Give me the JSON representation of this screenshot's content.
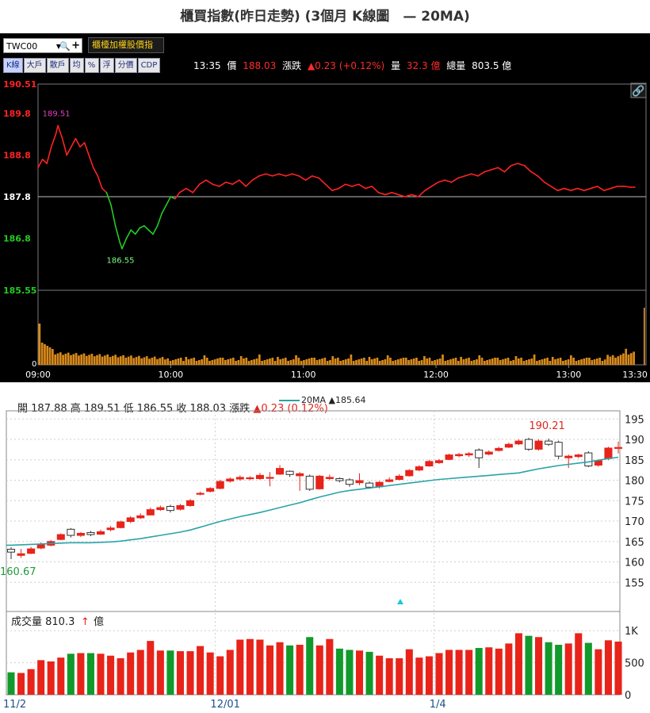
{
  "title": "櫃買指數(昨日走勢) (3個月 K線圖　— 20MA)",
  "intraday": {
    "symbol_value": "TWC00",
    "index_name": "櫃檯加權股價指",
    "tabs": [
      "K線",
      "大戶",
      "散戶",
      "均",
      "%",
      "浮",
      "分價",
      "CDP"
    ],
    "quote": {
      "time": "13:35",
      "price_label": "價",
      "price": "188.03",
      "change_label": "漲跌",
      "change": "▲0.23 (+0.12%)",
      "volume_label": "量",
      "volume": "32.3 億",
      "total_volume_label": "總量",
      "total_volume": "803.5 億"
    },
    "colors": {
      "up": "#ff2222",
      "down": "#22cc22",
      "reference": "#ffffff"
    },
    "chart_data": {
      "type": "line",
      "title": "",
      "reference": 187.8,
      "ylim": [
        185.55,
        190.51
      ],
      "y_tick_labels": [
        "190.51",
        "189.8",
        "188.8",
        "187.8",
        "186.8",
        "185.55"
      ],
      "x_tick_labels": [
        "09:00",
        "10:00",
        "11:00",
        "12:00",
        "13:00",
        "13:30"
      ],
      "annotations": [
        {
          "text": "189.51",
          "x": "09:09",
          "y": 189.51
        },
        {
          "text": "186.55",
          "x": "09:38",
          "y": 186.55
        }
      ],
      "price": [
        [
          "09:00",
          188.5
        ],
        [
          "09:02",
          188.7
        ],
        [
          "09:04",
          188.6
        ],
        [
          "09:06",
          189.0
        ],
        [
          "09:08",
          189.3
        ],
        [
          "09:09",
          189.51
        ],
        [
          "09:11",
          189.2
        ],
        [
          "09:13",
          188.8
        ],
        [
          "09:15",
          189.0
        ],
        [
          "09:17",
          189.2
        ],
        [
          "09:19",
          189.0
        ],
        [
          "09:21",
          189.1
        ],
        [
          "09:23",
          188.8
        ],
        [
          "09:25",
          188.5
        ],
        [
          "09:27",
          188.3
        ],
        [
          "09:29",
          188.0
        ],
        [
          "09:31",
          187.9
        ],
        [
          "09:33",
          187.6
        ],
        [
          "09:35",
          187.1
        ],
        [
          "09:37",
          186.7
        ],
        [
          "09:38",
          186.55
        ],
        [
          "09:40",
          186.8
        ],
        [
          "09:42",
          187.0
        ],
        [
          "09:44",
          186.9
        ],
        [
          "09:46",
          187.05
        ],
        [
          "09:48",
          187.1
        ],
        [
          "09:50",
          187.0
        ],
        [
          "09:52",
          186.9
        ],
        [
          "09:54",
          187.1
        ],
        [
          "09:56",
          187.4
        ],
        [
          "09:58",
          187.6
        ],
        [
          "10:00",
          187.8
        ],
        [
          "10:02",
          187.75
        ],
        [
          "10:04",
          187.9
        ],
        [
          "10:07",
          188.0
        ],
        [
          "10:10",
          187.9
        ],
        [
          "10:13",
          188.1
        ],
        [
          "10:16",
          188.2
        ],
        [
          "10:19",
          188.1
        ],
        [
          "10:22",
          188.05
        ],
        [
          "10:25",
          188.15
        ],
        [
          "10:28",
          188.1
        ],
        [
          "10:31",
          188.2
        ],
        [
          "10:34",
          188.05
        ],
        [
          "10:37",
          188.2
        ],
        [
          "10:40",
          188.3
        ],
        [
          "10:43",
          188.35
        ],
        [
          "10:46",
          188.3
        ],
        [
          "10:49",
          188.35
        ],
        [
          "10:52",
          188.3
        ],
        [
          "10:55",
          188.35
        ],
        [
          "10:58",
          188.3
        ],
        [
          "11:01",
          188.2
        ],
        [
          "11:04",
          188.3
        ],
        [
          "11:07",
          188.25
        ],
        [
          "11:10",
          188.1
        ],
        [
          "11:13",
          187.95
        ],
        [
          "11:16",
          188.0
        ],
        [
          "11:19",
          188.1
        ],
        [
          "11:22",
          188.05
        ],
        [
          "11:25",
          188.1
        ],
        [
          "11:28",
          188.0
        ],
        [
          "11:31",
          188.05
        ],
        [
          "11:34",
          187.9
        ],
        [
          "11:37",
          187.85
        ],
        [
          "11:40",
          187.9
        ],
        [
          "11:43",
          187.85
        ],
        [
          "11:46",
          187.8
        ],
        [
          "11:49",
          187.85
        ],
        [
          "11:52",
          187.8
        ],
        [
          "11:55",
          187.95
        ],
        [
          "11:58",
          188.05
        ],
        [
          "12:01",
          188.15
        ],
        [
          "12:04",
          188.2
        ],
        [
          "12:07",
          188.15
        ],
        [
          "12:10",
          188.25
        ],
        [
          "12:13",
          188.3
        ],
        [
          "12:16",
          188.35
        ],
        [
          "12:19",
          188.3
        ],
        [
          "12:22",
          188.4
        ],
        [
          "12:25",
          188.45
        ],
        [
          "12:28",
          188.5
        ],
        [
          "12:31",
          188.4
        ],
        [
          "12:34",
          188.55
        ],
        [
          "12:37",
          188.6
        ],
        [
          "12:40",
          188.55
        ],
        [
          "12:43",
          188.4
        ],
        [
          "12:46",
          188.3
        ],
        [
          "12:49",
          188.15
        ],
        [
          "12:52",
          188.05
        ],
        [
          "12:55",
          187.95
        ],
        [
          "12:58",
          188.0
        ],
        [
          "13:01",
          187.95
        ],
        [
          "13:04",
          188.0
        ],
        [
          "13:07",
          187.95
        ],
        [
          "13:10",
          188.0
        ],
        [
          "13:13",
          188.05
        ],
        [
          "13:16",
          187.95
        ],
        [
          "13:19",
          188.0
        ],
        [
          "13:22",
          188.05
        ],
        [
          "13:25",
          188.05
        ],
        [
          "13:28",
          188.03
        ],
        [
          "13:30",
          188.03
        ]
      ]
    }
  },
  "kline": {
    "header": {
      "open_label": "開",
      "open": "187.88",
      "high_label": "高",
      "high": "189.51",
      "low_label": "低",
      "low": "186.55",
      "close_label": "收",
      "close": "188.03",
      "change_label": "漲跌",
      "change": "▲0.23 (0.12%)"
    },
    "ma_legend": "20MA ▲185.64",
    "volume_label": "成交量",
    "volume_value": "810.3",
    "volume_arrow": "↑",
    "volume_unit": "億",
    "colors": {
      "up": "#e8231a",
      "down": "#119a2c",
      "ma": "#2aa3a8"
    },
    "chart_data": {
      "type": "candlestick",
      "title": "",
      "ylim": [
        150,
        197
      ],
      "y_ticks": [
        195,
        190,
        185,
        180,
        175,
        170,
        165,
        160,
        155
      ],
      "volume_y_ticks_labels": [
        "1K",
        "500",
        "0"
      ],
      "volume_ylim": [
        0,
        1250
      ],
      "x_tick_labels": [
        {
          "label": "11/2",
          "index": 0
        },
        {
          "label": "12/01",
          "index": 21
        },
        {
          "label": "1/4",
          "index": 43
        }
      ],
      "annotations": [
        {
          "text": "190.21",
          "index": 54
        },
        {
          "text": "160.67",
          "index": 0
        }
      ],
      "candles": [
        [
          163.1,
          162.4,
          163.6,
          160.67
        ],
        [
          161.6,
          162.0,
          163.2,
          161.0
        ],
        [
          162.1,
          163.2,
          163.7,
          161.9
        ],
        [
          163.4,
          164.2,
          164.8,
          163.1
        ],
        [
          164.1,
          165.0,
          165.4,
          163.8
        ],
        [
          165.5,
          166.7,
          167.0,
          165.3
        ],
        [
          168.0,
          166.5,
          168.3,
          166.0
        ],
        [
          166.5,
          167.0,
          167.3,
          166.1
        ],
        [
          167.2,
          166.7,
          167.6,
          166.3
        ],
        [
          166.8,
          167.4,
          167.9,
          166.6
        ],
        [
          167.9,
          168.3,
          168.8,
          167.5
        ],
        [
          168.4,
          169.8,
          170.1,
          168.2
        ],
        [
          169.9,
          170.8,
          171.2,
          169.5
        ],
        [
          170.8,
          171.3,
          171.9,
          170.5
        ],
        [
          171.5,
          172.8,
          173.3,
          171.4
        ],
        [
          172.8,
          173.3,
          173.8,
          172.5
        ],
        [
          173.6,
          172.6,
          174.0,
          172.1
        ],
        [
          172.9,
          173.8,
          174.2,
          172.6
        ],
        [
          173.8,
          175.0,
          175.4,
          173.5
        ],
        [
          176.6,
          176.8,
          177.2,
          176.3
        ],
        [
          177.3,
          178.0,
          178.3,
          177.0
        ],
        [
          178.0,
          179.7,
          180.1,
          177.8
        ],
        [
          179.8,
          180.3,
          180.7,
          179.4
        ],
        [
          180.3,
          180.7,
          181.2,
          179.9
        ],
        [
          180.5,
          180.6,
          181.0,
          180.0
        ],
        [
          180.4,
          181.2,
          181.8,
          180.1
        ],
        [
          180.6,
          180.7,
          182.0,
          178.5
        ],
        [
          181.5,
          182.9,
          183.7,
          181.3
        ],
        [
          182.2,
          181.4,
          182.4,
          180.8
        ],
        [
          181.1,
          181.6,
          182.0,
          177.4
        ],
        [
          181.0,
          177.8,
          181.4,
          177.4
        ],
        [
          177.9,
          181.0,
          181.3,
          177.7
        ],
        [
          180.4,
          180.7,
          181.4,
          180.0
        ],
        [
          180.4,
          179.9,
          180.7,
          179.5
        ],
        [
          180.1,
          179.0,
          180.5,
          178.4
        ],
        [
          179.4,
          179.9,
          181.7,
          178.8
        ],
        [
          179.3,
          178.3,
          179.7,
          177.9
        ],
        [
          178.4,
          179.5,
          179.8,
          178.0
        ],
        [
          179.7,
          180.1,
          180.7,
          179.5
        ],
        [
          180.2,
          181.0,
          181.5,
          180.0
        ],
        [
          181.1,
          182.4,
          182.7,
          180.9
        ],
        [
          182.5,
          183.3,
          183.7,
          182.2
        ],
        [
          183.5,
          184.6,
          185.0,
          183.3
        ],
        [
          184.3,
          184.8,
          185.2,
          184.0
        ],
        [
          185.1,
          186.2,
          186.5,
          184.9
        ],
        [
          186.0,
          186.3,
          186.7,
          185.6
        ],
        [
          186.2,
          186.5,
          186.9,
          185.7
        ],
        [
          187.4,
          185.5,
          187.8,
          183.0
        ],
        [
          186.4,
          186.9,
          187.3,
          186.1
        ],
        [
          187.3,
          187.8,
          188.2,
          187.0
        ],
        [
          188.1,
          188.8,
          189.2,
          187.9
        ],
        [
          188.9,
          189.6,
          190.0,
          188.6
        ],
        [
          190.0,
          187.6,
          190.4,
          187.2
        ],
        [
          187.6,
          189.6,
          190.0,
          187.3
        ],
        [
          189.6,
          188.8,
          190.21,
          188.4
        ],
        [
          189.3,
          185.9,
          189.7,
          185.2
        ],
        [
          185.5,
          185.9,
          186.3,
          183.0
        ],
        [
          185.8,
          186.2,
          186.5,
          185.4
        ],
        [
          186.7,
          183.5,
          187.1,
          183.2
        ],
        [
          183.7,
          184.8,
          185.1,
          183.3
        ],
        [
          185.3,
          187.88,
          188.2,
          184.9
        ],
        [
          187.88,
          188.03,
          189.51,
          186.55
        ]
      ],
      "ma20": [
        164.1,
        164.2,
        164.3,
        164.4,
        164.5,
        164.6,
        164.7,
        164.7,
        164.7,
        164.8,
        164.9,
        165.1,
        165.4,
        165.7,
        166.1,
        166.5,
        166.9,
        167.3,
        167.8,
        168.5,
        169.2,
        169.9,
        170.5,
        171.1,
        171.6,
        172.1,
        172.7,
        173.3,
        173.9,
        174.5,
        175.2,
        175.9,
        176.5,
        177.1,
        177.5,
        177.8,
        178.1,
        178.4,
        178.7,
        179.0,
        179.3,
        179.6,
        179.9,
        180.2,
        180.4,
        180.6,
        180.8,
        181.0,
        181.2,
        181.4,
        181.6,
        181.8,
        182.3,
        182.8,
        183.2,
        183.6,
        183.9,
        184.2,
        184.5,
        184.9,
        185.3,
        185.64
      ],
      "volume": [
        350,
        340,
        400,
        540,
        520,
        580,
        640,
        650,
        650,
        640,
        610,
        570,
        660,
        700,
        840,
        690,
        690,
        680,
        680,
        760,
        660,
        600,
        700,
        860,
        870,
        860,
        770,
        820,
        770,
        780,
        900,
        770,
        870,
        720,
        700,
        690,
        670,
        610,
        570,
        570,
        710,
        580,
        600,
        650,
        700,
        700,
        700,
        730,
        740,
        720,
        800,
        960,
        920,
        900,
        820,
        780,
        800,
        960,
        810,
        710,
        850,
        830
      ]
    }
  }
}
